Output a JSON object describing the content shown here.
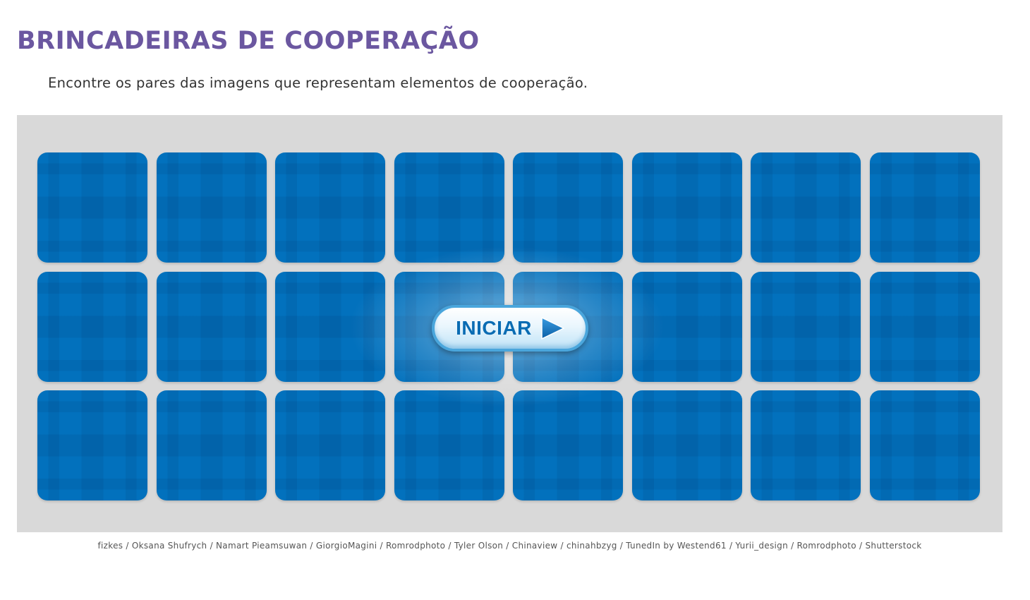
{
  "header": {
    "title": "BRINCADEIRAS DE COOPERAÇÃO",
    "instructions": "Encontre os pares das imagens que representam elementos de cooperação."
  },
  "game": {
    "rows": 3,
    "columns": 8,
    "card_color": "#0271bd",
    "board_color": "#d9d9d9",
    "start_button": {
      "label": "INICIAR",
      "icon": "play-arrow-icon"
    }
  },
  "footer": {
    "credits": "fizkes / Oksana Shufrych / Namart Pieamsuwan / GiorgioMagini / Romrodphoto / Tyler Olson / Chinaview / chinahbzyg / TunedIn by Westend61 / Yurii_design / Romrodphoto / Shutterstock"
  },
  "colors": {
    "title": "#6b57a0",
    "accent": "#0a6cb3"
  }
}
